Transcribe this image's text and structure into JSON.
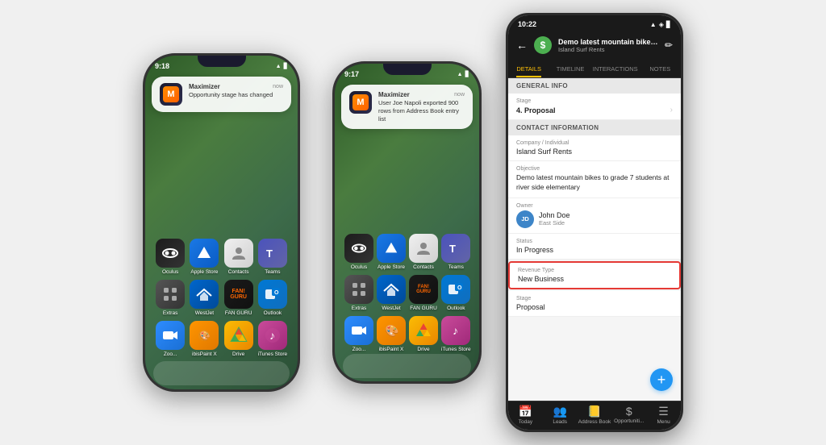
{
  "phone1": {
    "status_time": "9:18",
    "notification": {
      "app_name": "Maximizer",
      "time": "now",
      "message": "Opportunity stage has changed"
    },
    "apps": [
      {
        "id": "oculus",
        "label": "Oculus",
        "icon": "○"
      },
      {
        "id": "apple-store",
        "label": "Apple Store",
        "icon": "🅐"
      },
      {
        "id": "contacts",
        "label": "Contacts",
        "icon": "👤"
      },
      {
        "id": "teams",
        "label": "Teams",
        "icon": "T"
      },
      {
        "id": "extras",
        "label": "Extras",
        "icon": "⊞"
      },
      {
        "id": "westjet",
        "label": "WestJet",
        "icon": "✈"
      },
      {
        "id": "fanguru",
        "label": "FAN GURU",
        "icon": "★"
      },
      {
        "id": "outlook",
        "label": "Outlook",
        "icon": "O"
      },
      {
        "id": "zoom",
        "label": "Zoo...",
        "icon": "Z"
      },
      {
        "id": "ibispaint",
        "label": "ibisPaint X",
        "icon": "🎨"
      },
      {
        "id": "drive",
        "label": "Drive",
        "icon": "▲"
      },
      {
        "id": "itunes",
        "label": "iTunes Store",
        "icon": "♪"
      }
    ]
  },
  "phone2": {
    "status_time": "9:17",
    "notification": {
      "app_name": "Maximizer",
      "time": "now",
      "message": "User Joe Napoli exported 900 rows from Address Book entry list"
    },
    "apps": [
      {
        "id": "oculus",
        "label": "Oculus",
        "icon": "○"
      },
      {
        "id": "apple-store",
        "label": "Apple Store",
        "icon": "🅐"
      },
      {
        "id": "contacts",
        "label": "Contacts",
        "icon": "👤"
      },
      {
        "id": "teams",
        "label": "Teams",
        "icon": "T"
      },
      {
        "id": "extras",
        "label": "Extras",
        "icon": "⊞"
      },
      {
        "id": "westjet",
        "label": "WestJet",
        "icon": "✈"
      },
      {
        "id": "fanguru",
        "label": "FAN GURU",
        "icon": "★"
      },
      {
        "id": "outlook",
        "label": "Outlook",
        "icon": "O"
      },
      {
        "id": "zoom",
        "label": "Zoo...",
        "icon": "Z"
      },
      {
        "id": "ibispaint",
        "label": "ibisPaint X",
        "icon": "🎨"
      },
      {
        "id": "drive",
        "label": "Drive",
        "icon": "▲"
      },
      {
        "id": "itunes",
        "label": "iTunes Store",
        "icon": "♪"
      }
    ]
  },
  "android": {
    "status_time": "10:22",
    "header": {
      "title": "Demo latest mountain bikes ...",
      "subtitle": "Island Surf Rents",
      "edit_icon": "✏"
    },
    "tabs": [
      "DETAILS",
      "TIMELINE",
      "INTERACTIONS",
      "NOTES"
    ],
    "active_tab": "DETAILS",
    "sections": {
      "general_info": "General Info",
      "stage_label": "Stage",
      "stage_value": "4. Proposal",
      "contact_info": "Contact Information",
      "company_label": "Company / Individual",
      "company_value": "Island Surf Rents",
      "objective_label": "Objective",
      "objective_value": "Demo latest mountain bikes to grade 7 students at river side elementary",
      "owner_label": "Owner",
      "owner_name": "John Doe",
      "owner_team": "East Side",
      "owner_initials": "JD",
      "status_label": "Status",
      "status_value": "In Progress",
      "revenue_type_label": "Revenue Type",
      "revenue_type_value": "New Business",
      "stage_bottom_label": "Stage",
      "stage_bottom_value": "Proposal"
    },
    "bottom_bar": [
      "Today",
      "Leads",
      "Address Book",
      "Opportuniti...",
      "Menu"
    ]
  }
}
